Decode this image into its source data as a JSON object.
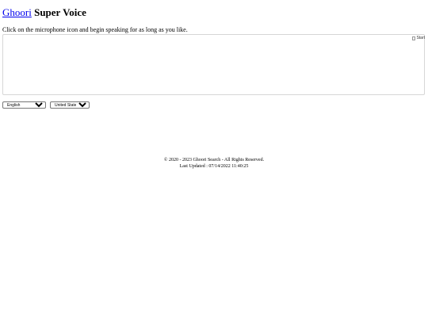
{
  "header": {
    "brand_link": "Ghoori",
    "title_rest": "Super Voice"
  },
  "instructions": "Click on the microphone icon and begin speaking for as long as you like.",
  "transcript": {
    "start_button_alt": "Start"
  },
  "language_select": {
    "selected": "English"
  },
  "dialect_select": {
    "selected": "United States"
  },
  "footer": {
    "copyright": "© 2020 - 2023 Ghoori Search - All Rights Reserved.",
    "last_updated": "Last Updated : 07/14/2022 11:40:25"
  }
}
